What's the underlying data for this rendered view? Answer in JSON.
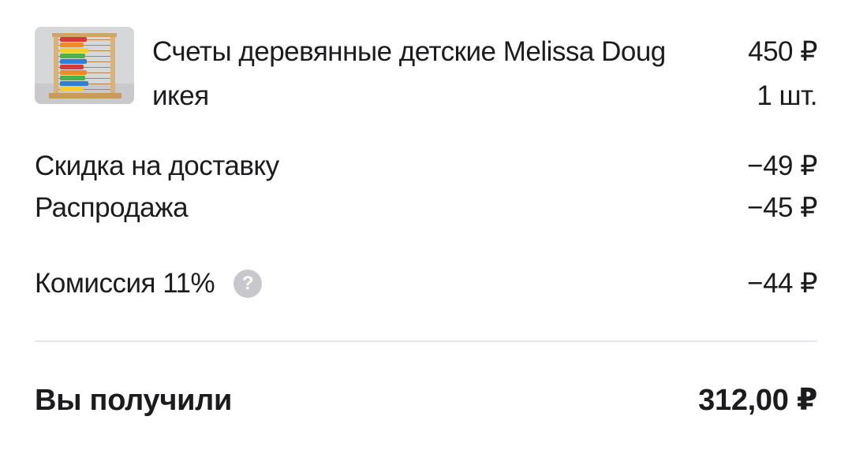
{
  "product": {
    "image_alt": "wooden abacus",
    "name": "Счеты деревянные детские Melissa Doug икея",
    "price": "450 ₽",
    "quantity": "1 шт."
  },
  "adjustments": [
    {
      "label": "Скидка на доставку",
      "value": "−49 ₽"
    },
    {
      "label": "Распродажа",
      "value": "−45 ₽"
    }
  ],
  "commission": {
    "label": "Комиссия 11%",
    "help_icon": "question-mark",
    "help_glyph": "?",
    "value": "−44 ₽"
  },
  "total": {
    "label": "Вы получили",
    "value": "312,00 ₽"
  },
  "colors": {
    "text": "#1c1c1e",
    "help_icon_bg": "#c7c7cc",
    "divider": "#e5e5ea"
  }
}
